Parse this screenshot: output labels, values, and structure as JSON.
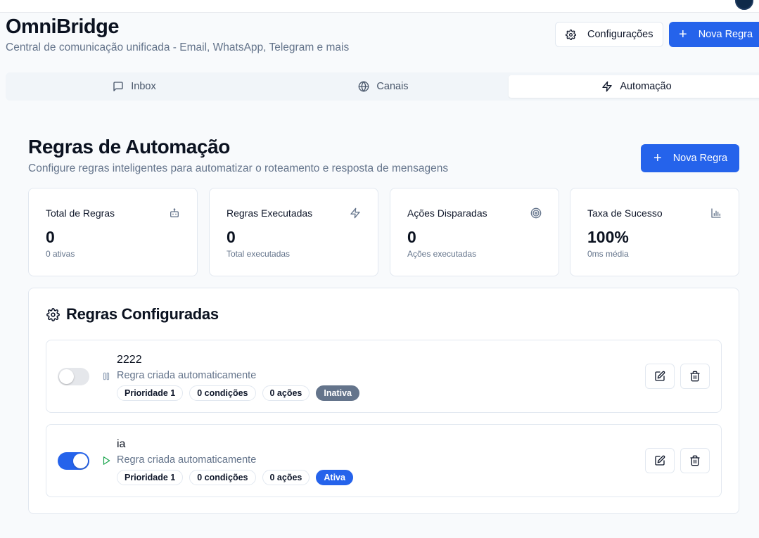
{
  "header": {
    "title": "OmniBridge",
    "subtitle": "Central de comunicação unificada - Email, WhatsApp, Telegram e mais",
    "settings_label": "Configurações",
    "new_rule_label": "Nova Regra"
  },
  "tabs": [
    {
      "label": "Inbox",
      "icon": "message-square-icon"
    },
    {
      "label": "Canais",
      "icon": "globe-icon"
    },
    {
      "label": "Automação",
      "icon": "zap-icon",
      "active": true
    }
  ],
  "section": {
    "title": "Regras de Automação",
    "subtitle": "Configure regras inteligentes para automatizar o roteamento e resposta de mensagens",
    "new_rule_label": "Nova Regra"
  },
  "stats": [
    {
      "label": "Total de Regras",
      "value": "0",
      "caption": "0 ativas",
      "icon": "bot-icon"
    },
    {
      "label": "Regras Executadas",
      "value": "0",
      "caption": "Total executadas",
      "icon": "zap-icon"
    },
    {
      "label": "Ações Disparadas",
      "value": "0",
      "caption": "Ações executadas",
      "icon": "target-icon"
    },
    {
      "label": "Taxa de Sucesso",
      "value": "100%",
      "caption": "0ms média",
      "icon": "bar-chart-icon"
    }
  ],
  "rules_card": {
    "title": "Regras Configuradas",
    "rules": [
      {
        "name": "2222",
        "description": "Regra criada automaticamente",
        "enabled": false,
        "priority": "Prioridade 1",
        "conditions": "0 condições",
        "actions": "0 ações",
        "status": "Inativa"
      },
      {
        "name": "ia",
        "description": "Regra criada automaticamente",
        "enabled": true,
        "priority": "Prioridade 1",
        "conditions": "0 condições",
        "actions": "0 ações",
        "status": "Ativa"
      }
    ]
  },
  "colors": {
    "primary": "#2563eb",
    "muted_text": "#64748b",
    "inactive_badge": "#64748b",
    "active_play": "#16a34a"
  }
}
